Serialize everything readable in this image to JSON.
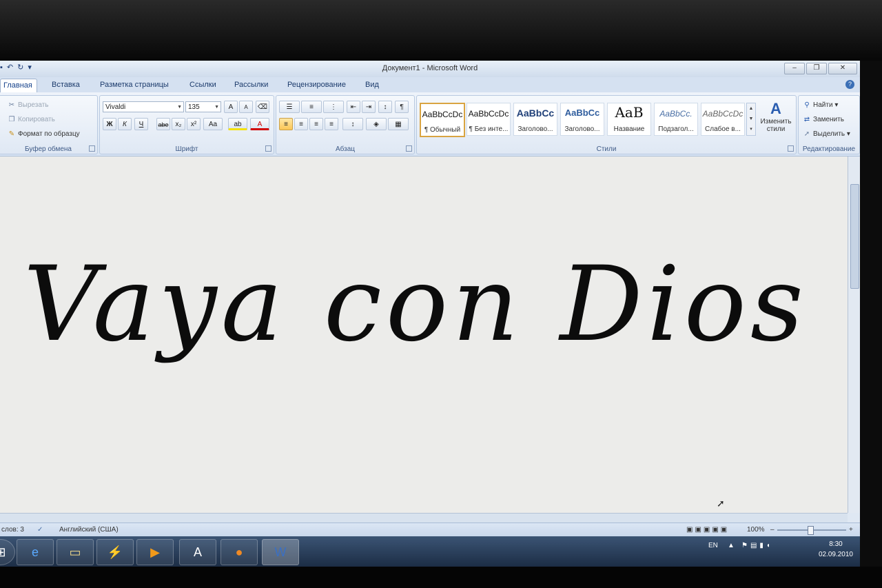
{
  "window": {
    "title": "Документ1 - Microsoft Word",
    "controls": {
      "minimize": "–",
      "restore": "❐",
      "close": "✕"
    }
  },
  "tabs": [
    {
      "label": "Главная",
      "active": true
    },
    {
      "label": "Вставка"
    },
    {
      "label": "Разметка страницы"
    },
    {
      "label": "Ссылки"
    },
    {
      "label": "Рассылки"
    },
    {
      "label": "Рецензирование"
    },
    {
      "label": "Вид"
    }
  ],
  "ribbon": {
    "clipboard": {
      "cut": "Вырезать",
      "copy": "Копировать",
      "format_painter": "Формат по образцу",
      "label": "Буфер обмена"
    },
    "font": {
      "font_name": "Vivaldi",
      "font_size": "135",
      "label": "Шрифт",
      "bold": "Ж",
      "italic": "К",
      "underline": "Ч",
      "strike": "abe",
      "subscript": "x₂",
      "superscript": "x²",
      "change_case": "Aa",
      "grow": "A",
      "shrink": "A",
      "highlight": "ab",
      "font_color": "A"
    },
    "paragraph": {
      "label": "Абзац",
      "show_marks": "¶"
    },
    "styles": {
      "label": "Стили",
      "items": [
        {
          "sample": "AaBbCcDc",
          "name": "¶ Обычный",
          "selected": true
        },
        {
          "sample": "AaBbCcDc",
          "name": "¶ Без инте..."
        },
        {
          "sample": "AaBbCc",
          "name": "Заголово..."
        },
        {
          "sample": "AaBbCc",
          "name": "Заголово..."
        },
        {
          "sample": "AaB",
          "name": "Название"
        },
        {
          "sample": "AaBbCc.",
          "name": "Подзагол..."
        },
        {
          "sample": "AaBbCcDc",
          "name": "Слабое в..."
        }
      ],
      "change_styles_line1": "Изменить",
      "change_styles_line2": "стили"
    },
    "editing": {
      "label": "Редактирование",
      "find": "Найти",
      "replace": "Заменить",
      "select": "Выделить"
    }
  },
  "document": {
    "text": "Vaya con Dios"
  },
  "statusbar": {
    "words": "слов: 3",
    "language": "Английский (США)",
    "zoom": "100%",
    "zoom_out": "–",
    "zoom_in": "+"
  },
  "taskbar": {
    "language": "EN",
    "time": "8:30",
    "date": "02.09.2010"
  }
}
